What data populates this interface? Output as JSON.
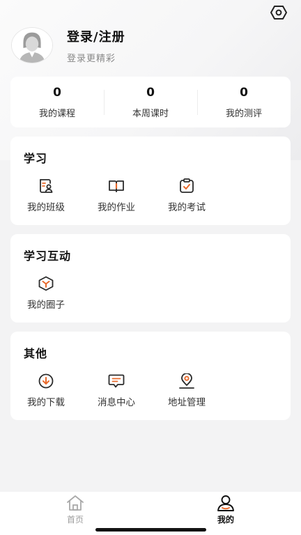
{
  "header": {
    "login_title": "登录/注册",
    "login_subtitle": "登录更精彩",
    "settings_icon": "settings-hex-icon",
    "avatar_icon": "default-avatar"
  },
  "stats": [
    {
      "value": "0",
      "label": "我的课程"
    },
    {
      "value": "0",
      "label": "本周课时"
    },
    {
      "value": "0",
      "label": "我的测评"
    }
  ],
  "sections": {
    "study": {
      "title": "学习",
      "items": [
        {
          "label": "我的班级",
          "icon": "class-icon"
        },
        {
          "label": "我的作业",
          "icon": "homework-book-icon"
        },
        {
          "label": "我的考试",
          "icon": "exam-clipboard-icon"
        }
      ]
    },
    "interact": {
      "title": "学习互动",
      "items": [
        {
          "label": "我的圈子",
          "icon": "circle-hexagon-icon"
        }
      ]
    },
    "other": {
      "title": "其他",
      "items": [
        {
          "label": "我的下载",
          "icon": "download-icon"
        },
        {
          "label": "消息中心",
          "icon": "message-icon"
        },
        {
          "label": "地址管理",
          "icon": "location-pin-icon"
        }
      ]
    }
  },
  "tabbar": {
    "home_label": "首页",
    "mine_label": "我的"
  },
  "colors": {
    "accent": "#e8692b",
    "icon_stroke": "#2b2b2b",
    "background": "#f3f3f4"
  }
}
